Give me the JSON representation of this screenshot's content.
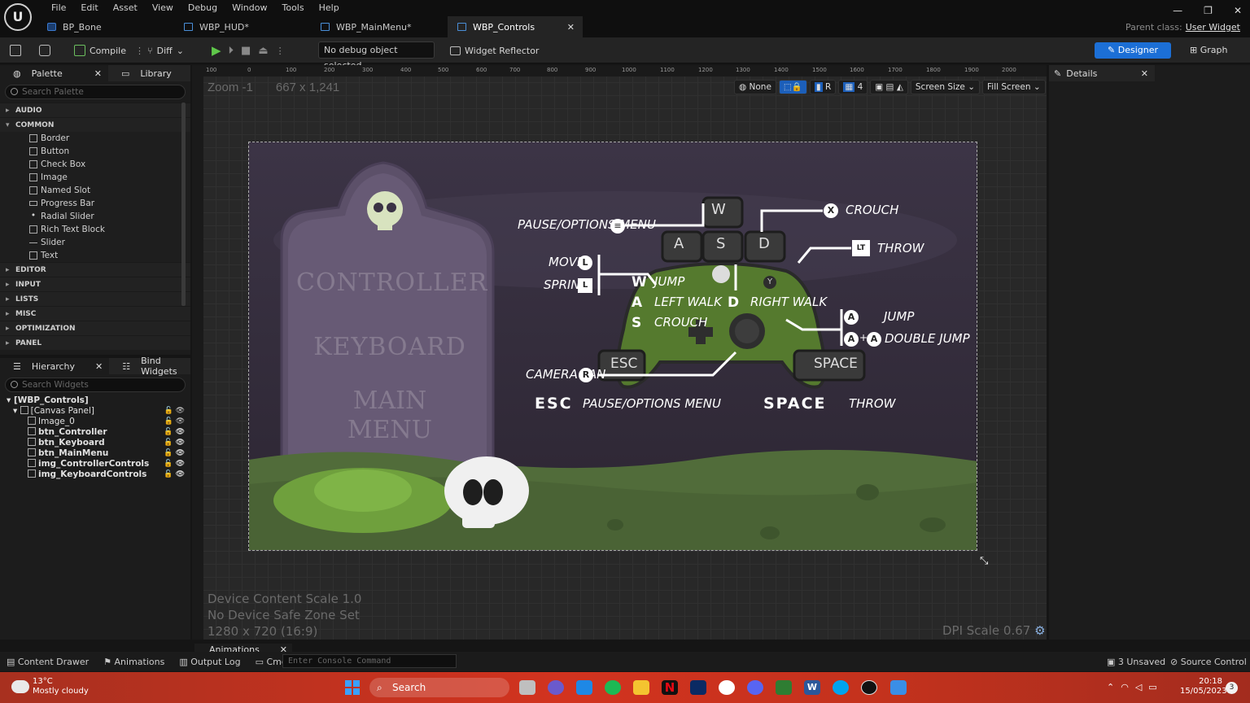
{
  "menu": [
    "File",
    "Edit",
    "Asset",
    "View",
    "Debug",
    "Window",
    "Tools",
    "Help"
  ],
  "tabs": [
    {
      "label": "BP_Bone"
    },
    {
      "label": "WBP_HUD*"
    },
    {
      "label": "WBP_MainMenu*"
    },
    {
      "label": "WBP_Controls"
    }
  ],
  "parent_class": {
    "label": "Parent class:",
    "value": "User Widget"
  },
  "toolbar": {
    "compile": "Compile",
    "diff": "Diff",
    "debug_select": "No debug object selected",
    "widget_reflector": "Widget Reflector",
    "designer": "Designer",
    "graph": "Graph"
  },
  "palette": {
    "tab_palette": "Palette",
    "tab_library": "Library",
    "search_placeholder": "Search Palette",
    "categories_before": [
      "AUDIO"
    ],
    "common": "COMMON",
    "items": [
      "Border",
      "Button",
      "Check Box",
      "Image",
      "Named Slot",
      "Progress Bar",
      "Radial Slider",
      "Rich Text Block",
      "Slider",
      "Text"
    ],
    "categories_after": [
      "EDITOR",
      "INPUT",
      "LISTS",
      "MISC",
      "OPTIMIZATION",
      "PANEL"
    ]
  },
  "hierarchy": {
    "tab_hierarchy": "Hierarchy",
    "tab_bind": "Bind Widgets",
    "search_placeholder": "Search Widgets",
    "root": "[WBP_Controls]",
    "canvas": "[Canvas Panel]",
    "children": [
      "Image_0",
      "btn_Controller",
      "btn_Keyboard",
      "btn_MainMenu",
      "img_ControllerControls",
      "img_KeyboardControls"
    ]
  },
  "viewport": {
    "zoom": "Zoom -1",
    "size": "667 x 1,241",
    "none": "None",
    "r": "R",
    "grid": "4",
    "screen_size": "Screen Size",
    "fill_screen": "Fill Screen",
    "device_scale": "Device Content Scale 1.0",
    "safe_zone": "No Device Safe Zone Set",
    "resolution": "1280 x 720 (16:9)",
    "dpi": "DPI Scale 0.67",
    "ruler_x": [
      "100",
      "0",
      "100",
      "200",
      "300",
      "400",
      "500",
      "600",
      "700",
      "800",
      "900",
      "1000",
      "1100",
      "1200",
      "1300",
      "1400",
      "1500",
      "1600",
      "1700",
      "1800",
      "1900",
      "2000"
    ]
  },
  "gravestone": {
    "btn_controller": "CONTROLLER",
    "btn_keyboard": "KEYBOARD",
    "btn_main_1": "MAIN",
    "btn_main_2": "MENU"
  },
  "controls": {
    "pause_menu": "PAUSE/OPTIONS MENU",
    "crouch": "CROUCH",
    "throw": "THROW",
    "move": "MOVE",
    "sprint": "SPRINT",
    "key_w": "W",
    "key_a": "A",
    "key_s": "S",
    "key_d": "D",
    "jump": "JUMP",
    "left_walk": "LEFT WALK",
    "right_walk": "RIGHT WALK",
    "crouch2": "CROUCH",
    "jump_a": "JUMP",
    "double_jump": "DOUBLE JUMP",
    "camera_pan": "CAMERA PAN",
    "esc": "ESC",
    "space": "SPACE",
    "esc_label": "ESC",
    "esc_desc": "PAUSE/OPTIONS MENU",
    "space_label": "SPACE",
    "space_desc": "THROW",
    "btn_x": "X",
    "btn_lt": "LT",
    "btn_l": "L",
    "btn_r": "R",
    "btn_a": "A",
    "btn_y": "Y",
    "plus": "+"
  },
  "details": {
    "title": "Details"
  },
  "bottom": {
    "content_drawer": "Content Drawer",
    "animations": "Animations",
    "output_log": "Output Log",
    "cmd": "Cmd",
    "console_placeholder": "Enter Console Command",
    "anim_tab": "Animations",
    "unsaved": "3 Unsaved",
    "source_control": "Source Control"
  },
  "taskbar": {
    "temp": "13°C",
    "weather": "Mostly cloudy",
    "search": "Search",
    "time": "20:18",
    "date": "15/05/2023",
    "badge": "3"
  }
}
